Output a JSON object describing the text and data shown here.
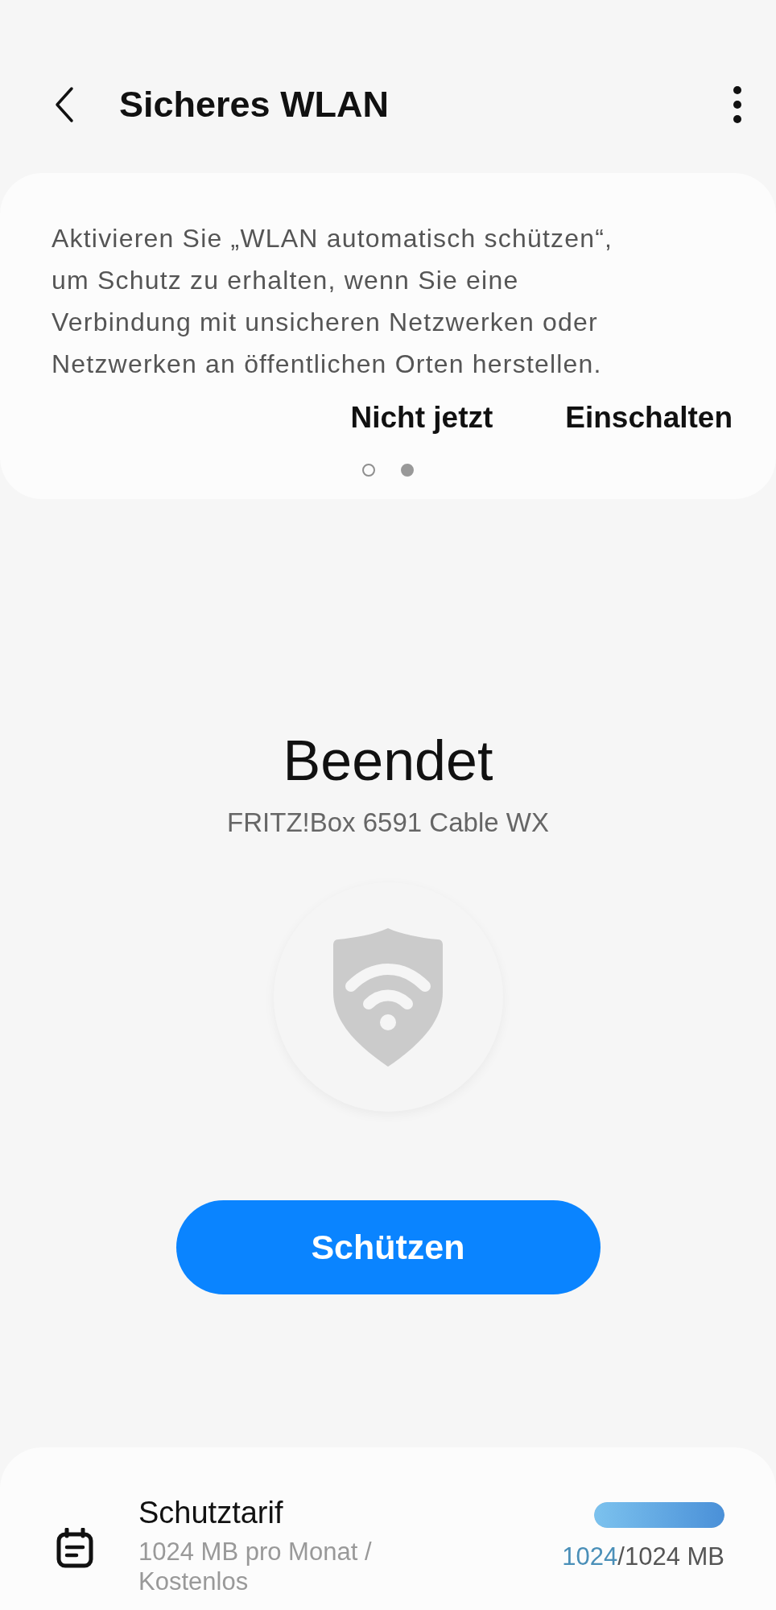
{
  "header": {
    "title": "Sicheres WLAN"
  },
  "banner": {
    "text": "Aktivieren Sie „WLAN automatisch schützen“, um Schutz zu erhalten, wenn Sie eine Verbindung mit unsicheren Netzwerken oder Netzwerken an öffentlichen Orten herstellen.",
    "actions": [
      "Nicht jetzt",
      "Einschalten"
    ],
    "pages": [
      {
        "selected": false
      },
      {
        "selected": true
      }
    ]
  },
  "status": {
    "title": "Beendet",
    "network": "FRITZ!Box 6591 Cable WX"
  },
  "protect_button": "Schützen",
  "plan": {
    "title": "Schutztarif",
    "subtitle": "1024 MB pro Monat / Kostenlos",
    "level": 1.0,
    "used": "1024",
    "total": "/1024 MB"
  }
}
